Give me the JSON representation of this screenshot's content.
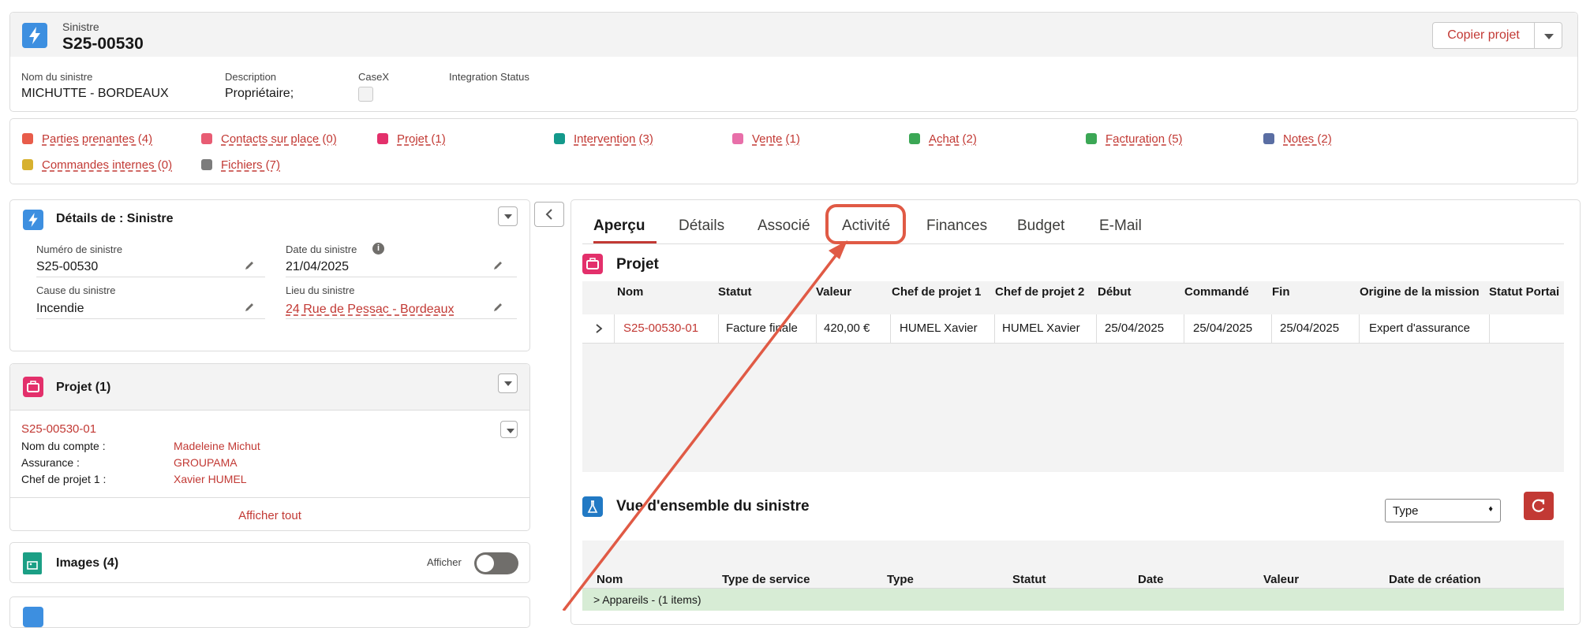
{
  "header": {
    "object_type": "Sinistre",
    "record_name": "S25-00530",
    "copy_button": "Copier projet",
    "fields": [
      {
        "label": "Nom du sinistre",
        "value": "MICHUTTE - BORDEAUX"
      },
      {
        "label": "Description",
        "value": "Propriétaire;"
      },
      {
        "label": "CaseX",
        "value": ""
      },
      {
        "label": "Integration Status",
        "value": ""
      }
    ]
  },
  "related_links": [
    {
      "label": "Parties prenantes (4)",
      "color": "#e85c4a"
    },
    {
      "label": "Contacts sur place (0)",
      "color": "#e85c73"
    },
    {
      "label": "Projet (1)",
      "color": "#e3306b"
    },
    {
      "label": "Intervention (3)",
      "color": "#13998b"
    },
    {
      "label": "Vente (1)",
      "color": "#e86fa9"
    },
    {
      "label": "Achat (2)",
      "color": "#3ba755"
    },
    {
      "label": "Facturation (5)",
      "color": "#3ba755"
    },
    {
      "label": "Notes (2)",
      "color": "#5a6ea3"
    },
    {
      "label": "Commandes internes (0)",
      "color": "#d7b12f"
    },
    {
      "label": "Fichiers (7)",
      "color": "#7c7c7c"
    }
  ],
  "details": {
    "title": "Détails de : Sinistre",
    "fields": [
      {
        "label": "Numéro de sinistre",
        "value": "S25-00530"
      },
      {
        "label": "Date du sinistre",
        "value": "21/04/2025"
      },
      {
        "label": "Cause du sinistre",
        "value": "Incendie"
      },
      {
        "label": "Lieu du sinistre",
        "value": "24 Rue de Pessac - Bordeaux"
      }
    ]
  },
  "projet_card": {
    "title": "Projet (1)",
    "record": "S25-00530-01",
    "rows": [
      {
        "label": "Nom du compte :",
        "value": "Madeleine Michut"
      },
      {
        "label": "Assurance :",
        "value": "GROUPAMA"
      },
      {
        "label": "Chef de projet 1 :",
        "value": "Xavier HUMEL"
      }
    ],
    "show_all": "Afficher tout"
  },
  "images_card": {
    "title": "Images (4)",
    "toggle_label": "Afficher"
  },
  "tabs": [
    "Aperçu",
    "Détails",
    "Associé",
    "Activité",
    "Finances",
    "Budget",
    "E-Mail"
  ],
  "active_tab": "Aperçu",
  "projet_table": {
    "title": "Projet",
    "columns": [
      "Nom",
      "Statut",
      "Valeur",
      "Chef de projet 1",
      "Chef de projet 2",
      "Début",
      "Commandé",
      "Fin",
      "Origine de la mission",
      "Statut Portai"
    ],
    "rows": [
      [
        "S25-00530-01",
        "Facture finale",
        "420,00 €",
        "HUMEL Xavier",
        "HUMEL Xavier",
        "25/04/2025",
        "25/04/2025",
        "25/04/2025",
        "Expert d'assurance",
        ""
      ]
    ]
  },
  "overview": {
    "title": "Vue d'ensemble du sinistre",
    "select_value": "Type",
    "columns": [
      "Nom",
      "Type de service",
      "Type",
      "Statut",
      "Date",
      "Valeur",
      "Date de création"
    ],
    "group_row": "> Appareils - (1 items)"
  },
  "colors": {
    "accent": "#c23934",
    "annotation": "#e05a45",
    "header_bg": "#f3f3f3"
  }
}
